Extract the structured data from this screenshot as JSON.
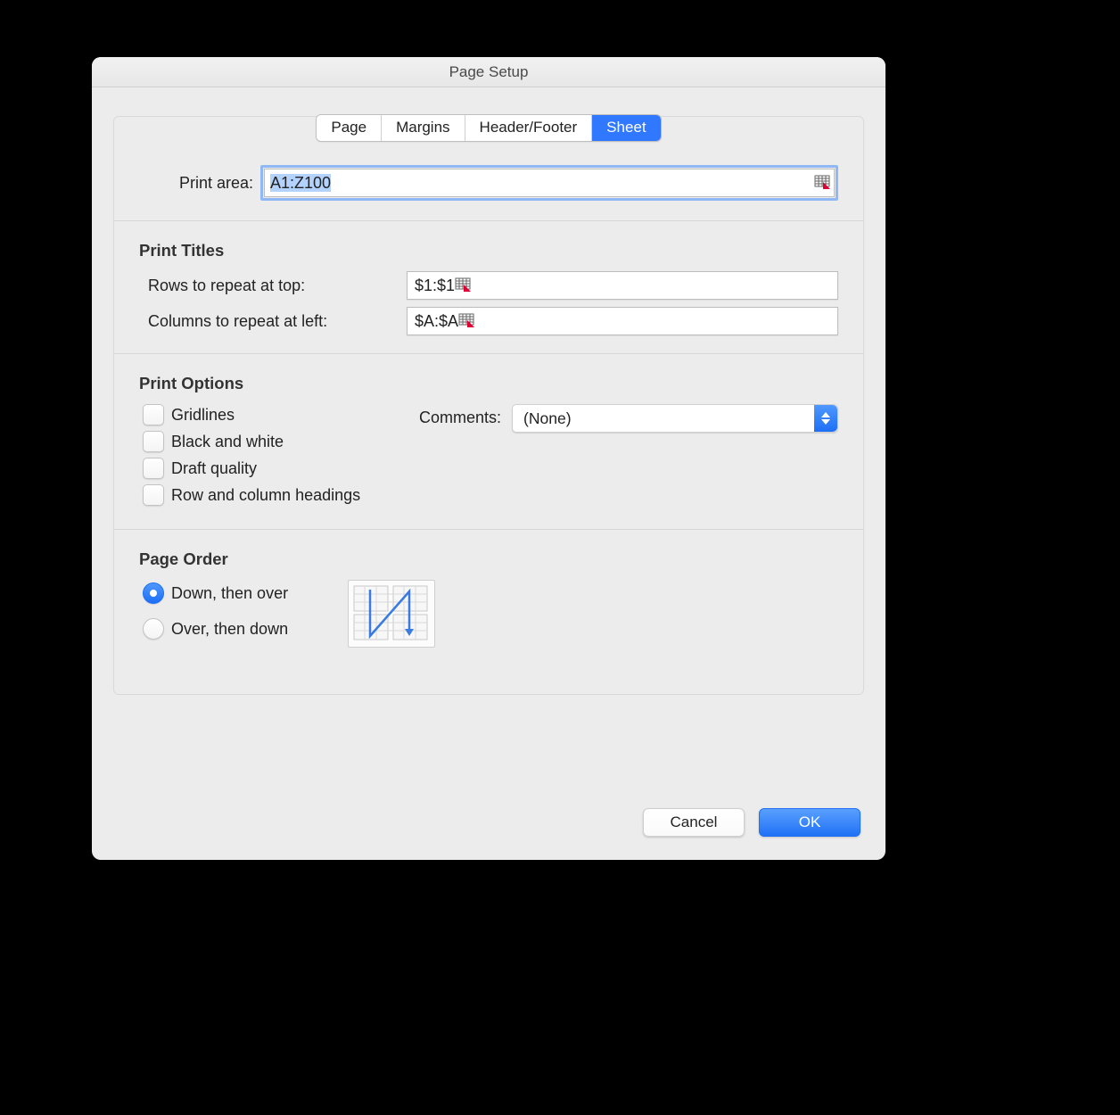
{
  "window": {
    "title": "Page Setup"
  },
  "tabs": {
    "page": "Page",
    "margins": "Margins",
    "header_footer": "Header/Footer",
    "sheet": "Sheet",
    "selected": "sheet"
  },
  "print_area": {
    "label": "Print area:",
    "value": "A1:Z100"
  },
  "print_titles": {
    "heading": "Print Titles",
    "rows_label": "Rows to repeat at top:",
    "rows_value": "$1:$1",
    "cols_label": "Columns to repeat at left:",
    "cols_value": "$A:$A"
  },
  "print_options": {
    "heading": "Print Options",
    "gridlines": "Gridlines",
    "black_white": "Black and white",
    "draft_quality": "Draft quality",
    "row_col_headings": "Row and column headings",
    "comments_label": "Comments:",
    "comments_value": "(None)"
  },
  "page_order": {
    "heading": "Page Order",
    "down_over": "Down, then over",
    "over_down": "Over, then down"
  },
  "buttons": {
    "cancel": "Cancel",
    "ok": "OK"
  }
}
